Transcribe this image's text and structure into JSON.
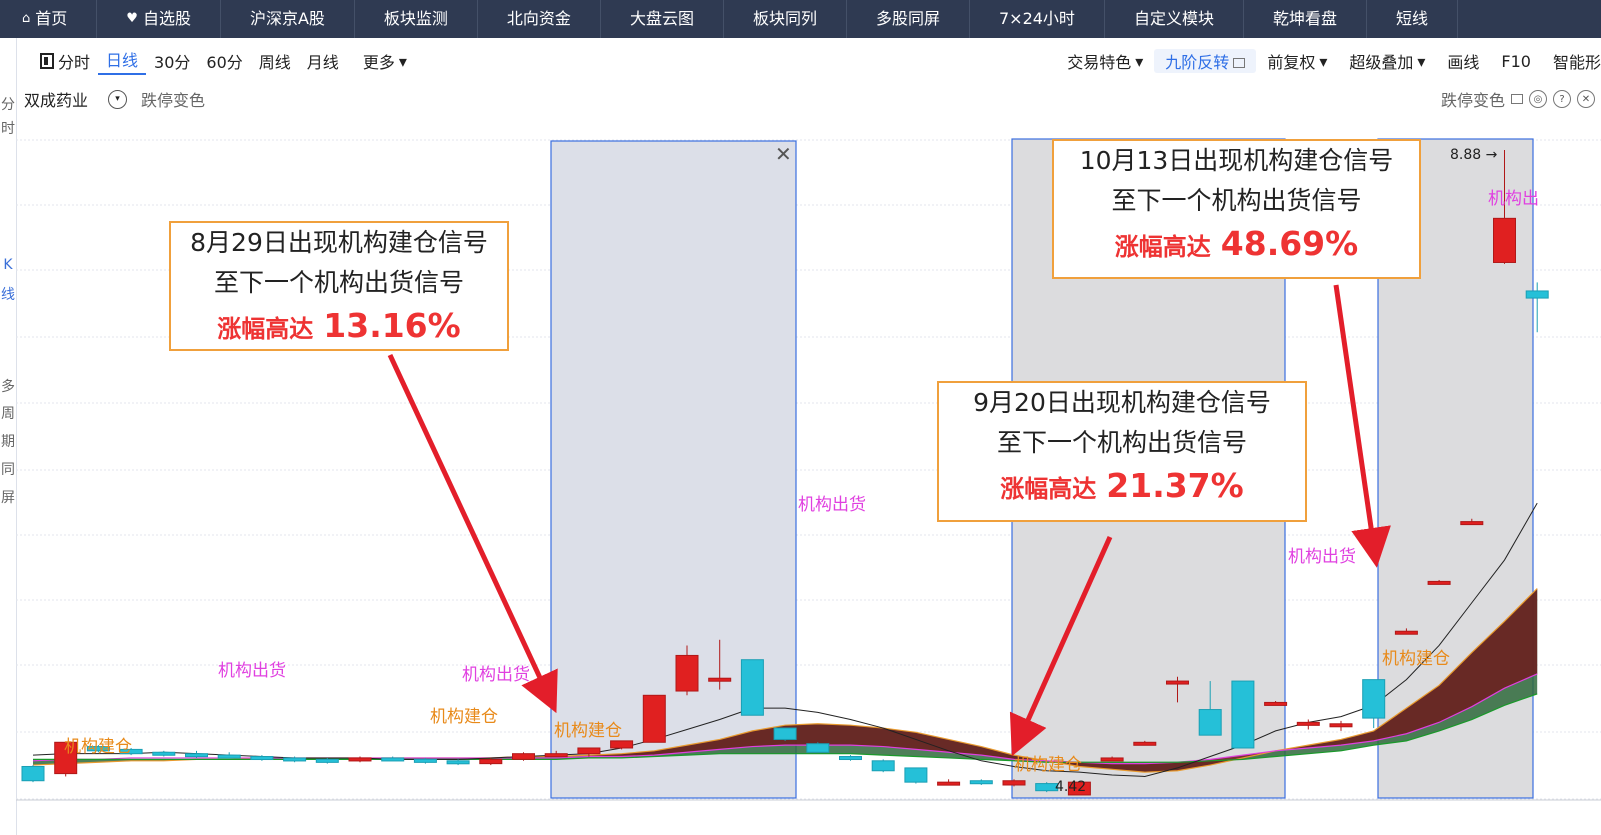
{
  "nav": {
    "items": [
      {
        "label": "首页",
        "icon": "home-icon"
      },
      {
        "label": "自选股",
        "icon": "heart-icon"
      },
      {
        "label": "沪深京A股"
      },
      {
        "label": "板块监测"
      },
      {
        "label": "北向资金"
      },
      {
        "label": "大盘云图"
      },
      {
        "label": "板块同列"
      },
      {
        "label": "多股同屏"
      },
      {
        "label": "7×24小时"
      },
      {
        "label": "自定义模块"
      },
      {
        "label": "乾坤看盘"
      },
      {
        "label": "短线"
      }
    ]
  },
  "left_strip": {
    "a": "分",
    "b": "时",
    "c": "K",
    "d": "线",
    "e": "多",
    "f": "周",
    "g": "期",
    "h": "同",
    "i": "屏"
  },
  "toolbar": {
    "periods": [
      "分时",
      "日线",
      "30分",
      "60分",
      "周线",
      "月线",
      "更多"
    ],
    "active": "日线",
    "right": [
      "交易特色",
      "九阶反转",
      "前复权",
      "超级叠加",
      "画线",
      "F10",
      "智能形"
    ]
  },
  "subbar": {
    "stock_name": "双成药业",
    "mode": "跌停变色",
    "right_mode": "跌停变色"
  },
  "callouts": [
    {
      "line1": "8月29日出现机构建仓信号",
      "line2": "至下一个机构出货信号",
      "prefix": "涨幅高达",
      "value": "13.16%"
    },
    {
      "line1": "9月20日出现机构建仓信号",
      "line2": "至下一个机构出货信号",
      "prefix": "涨幅高达",
      "value": "21.37%"
    },
    {
      "line1": "10月13日出现机构建仓信号",
      "line2": "至下一个机构出货信号",
      "prefix": "涨幅高达",
      "value": "48.69%"
    }
  ],
  "chart_data": {
    "type": "candlestick",
    "high_label": "8.88",
    "low_label": "4.42",
    "signal_buy": "机构建仓",
    "signal_sell": "机构出货",
    "signal_sell_partial": "机构出",
    "candles": [
      {
        "o": 4.55,
        "c": 4.45,
        "h": 4.56,
        "l": 4.44
      },
      {
        "o": 4.5,
        "c": 4.72,
        "h": 4.72,
        "l": 4.48
      },
      {
        "o": 4.69,
        "c": 4.66,
        "h": 4.7,
        "l": 4.65
      },
      {
        "o": 4.67,
        "c": 4.64,
        "h": 4.68,
        "l": 4.63
      },
      {
        "o": 4.65,
        "c": 4.63,
        "h": 4.66,
        "l": 4.62
      },
      {
        "o": 4.64,
        "c": 4.62,
        "h": 4.66,
        "l": 4.61
      },
      {
        "o": 4.63,
        "c": 4.62,
        "h": 4.65,
        "l": 4.61
      },
      {
        "o": 4.62,
        "c": 4.6,
        "h": 4.63,
        "l": 4.59
      },
      {
        "o": 4.61,
        "c": 4.59,
        "h": 4.62,
        "l": 4.58
      },
      {
        "o": 4.6,
        "c": 4.59,
        "h": 4.61,
        "l": 4.57
      },
      {
        "o": 4.59,
        "c": 4.61,
        "h": 4.62,
        "l": 4.58
      },
      {
        "o": 4.61,
        "c": 4.6,
        "h": 4.62,
        "l": 4.59
      },
      {
        "o": 4.6,
        "c": 4.58,
        "h": 4.61,
        "l": 4.57
      },
      {
        "o": 4.59,
        "c": 4.57,
        "h": 4.6,
        "l": 4.56
      },
      {
        "o": 4.57,
        "c": 4.6,
        "h": 4.61,
        "l": 4.56
      },
      {
        "o": 4.6,
        "c": 4.64,
        "h": 4.65,
        "l": 4.59
      },
      {
        "o": 4.63,
        "c": 4.64,
        "h": 4.66,
        "l": 4.62
      },
      {
        "o": 4.64,
        "c": 4.68,
        "h": 4.68,
        "l": 4.62
      },
      {
        "o": 4.68,
        "c": 4.73,
        "h": 4.73,
        "l": 4.67
      },
      {
        "o": 4.72,
        "c": 5.05,
        "h": 5.05,
        "l": 4.72
      },
      {
        "o": 5.08,
        "c": 5.33,
        "h": 5.4,
        "l": 5.05
      },
      {
        "o": 5.16,
        "c": 5.17,
        "h": 5.44,
        "l": 5.09
      },
      {
        "o": 5.3,
        "c": 4.91,
        "h": 5.3,
        "l": 4.91
      },
      {
        "o": 4.82,
        "c": 4.74,
        "h": 4.82,
        "l": 4.73
      },
      {
        "o": 4.71,
        "c": 4.65,
        "h": 4.72,
        "l": 4.65
      },
      {
        "o": 4.62,
        "c": 4.6,
        "h": 4.63,
        "l": 4.59
      },
      {
        "o": 4.59,
        "c": 4.52,
        "h": 4.6,
        "l": 4.51
      },
      {
        "o": 4.54,
        "c": 4.44,
        "h": 4.54,
        "l": 4.43
      },
      {
        "o": 4.44,
        "c": 4.44,
        "h": 4.46,
        "l": 4.42
      },
      {
        "o": 4.45,
        "c": 4.43,
        "h": 4.46,
        "l": 4.42
      },
      {
        "o": 4.42,
        "c": 4.45,
        "h": 4.46,
        "l": 4.41
      },
      {
        "o": 4.43,
        "c": 4.38,
        "h": 4.44,
        "l": 4.37
      },
      {
        "o": 4.35,
        "c": 4.44,
        "h": 4.44,
        "l": 4.35
      },
      {
        "o": 4.61,
        "c": 4.61,
        "h": 4.62,
        "l": 4.6
      },
      {
        "o": 4.71,
        "c": 4.72,
        "h": 4.73,
        "l": 4.7
      },
      {
        "o": 5.15,
        "c": 5.15,
        "h": 5.18,
        "l": 5.0
      },
      {
        "o": 4.95,
        "c": 4.77,
        "h": 5.15,
        "l": 4.77
      },
      {
        "o": 5.15,
        "c": 4.68,
        "h": 5.15,
        "l": 4.69
      },
      {
        "o": 5.0,
        "c": 5.0,
        "h": 5.01,
        "l": 4.98
      },
      {
        "o": 4.84,
        "c": 4.86,
        "h": 4.88,
        "l": 4.81
      },
      {
        "o": 4.83,
        "c": 4.85,
        "h": 4.87,
        "l": 4.8
      },
      {
        "o": 5.16,
        "c": 4.89,
        "h": 5.16,
        "l": 4.82
      },
      {
        "o": 5.5,
        "c": 5.5,
        "h": 5.52,
        "l": 5.48
      },
      {
        "o": 5.85,
        "c": 5.85,
        "h": 5.86,
        "l": 5.84
      },
      {
        "o": 6.27,
        "c": 6.27,
        "h": 6.29,
        "l": 6.26
      },
      {
        "o": 8.09,
        "c": 8.4,
        "h": 8.88,
        "l": 8.08
      },
      {
        "o": 7.89,
        "c": 7.84,
        "h": 7.95,
        "l": 7.6
      }
    ],
    "ma_black": [
      4.63,
      4.64,
      4.64,
      4.64,
      4.65,
      4.64,
      4.63,
      4.62,
      4.61,
      4.61,
      4.61,
      4.6,
      4.6,
      4.6,
      4.61,
      4.62,
      4.63,
      4.64,
      4.68,
      4.74,
      4.81,
      4.88,
      4.96,
      4.96,
      4.93,
      4.88,
      4.82,
      4.74,
      4.66,
      4.59,
      4.55,
      4.52,
      4.51,
      4.49,
      4.48,
      4.54,
      4.62,
      4.7,
      4.8,
      4.86,
      4.9,
      4.98,
      5.16,
      5.4,
      5.7,
      6.0,
      6.4
    ],
    "ma_orange": [
      4.56,
      4.57,
      4.58,
      4.59,
      4.59,
      4.6,
      4.6,
      4.61,
      4.61,
      4.61,
      4.61,
      4.61,
      4.61,
      4.61,
      4.61,
      4.62,
      4.62,
      4.63,
      4.64,
      4.66,
      4.7,
      4.74,
      4.8,
      4.84,
      4.85,
      4.84,
      4.82,
      4.79,
      4.74,
      4.69,
      4.63,
      4.59,
      4.55,
      4.53,
      4.51,
      4.52,
      4.56,
      4.61,
      4.66,
      4.7,
      4.74,
      4.8,
      4.96,
      5.12,
      5.35,
      5.57,
      5.8
    ],
    "ma_magenta": [
      4.59,
      4.6,
      4.6,
      4.61,
      4.61,
      4.61,
      4.61,
      4.61,
      4.61,
      4.61,
      4.61,
      4.61,
      4.61,
      4.61,
      4.61,
      4.61,
      4.61,
      4.62,
      4.62,
      4.63,
      4.65,
      4.67,
      4.69,
      4.7,
      4.7,
      4.7,
      4.69,
      4.67,
      4.65,
      4.63,
      4.6,
      4.59,
      4.58,
      4.57,
      4.57,
      4.58,
      4.6,
      4.63,
      4.66,
      4.68,
      4.7,
      4.73,
      4.78,
      4.86,
      4.97,
      5.1,
      5.2
    ],
    "ma_green": [
      4.6,
      4.6,
      4.6,
      4.6,
      4.6,
      4.6,
      4.6,
      4.6,
      4.6,
      4.6,
      4.6,
      4.6,
      4.6,
      4.6,
      4.6,
      4.6,
      4.6,
      4.61,
      4.61,
      4.62,
      4.63,
      4.64,
      4.64,
      4.64,
      4.64,
      4.64,
      4.63,
      4.62,
      4.61,
      4.6,
      4.59,
      4.58,
      4.58,
      4.58,
      4.58,
      4.58,
      4.59,
      4.6,
      4.62,
      4.64,
      4.66,
      4.7,
      4.73,
      4.8,
      4.88,
      4.98,
      5.06
    ]
  }
}
